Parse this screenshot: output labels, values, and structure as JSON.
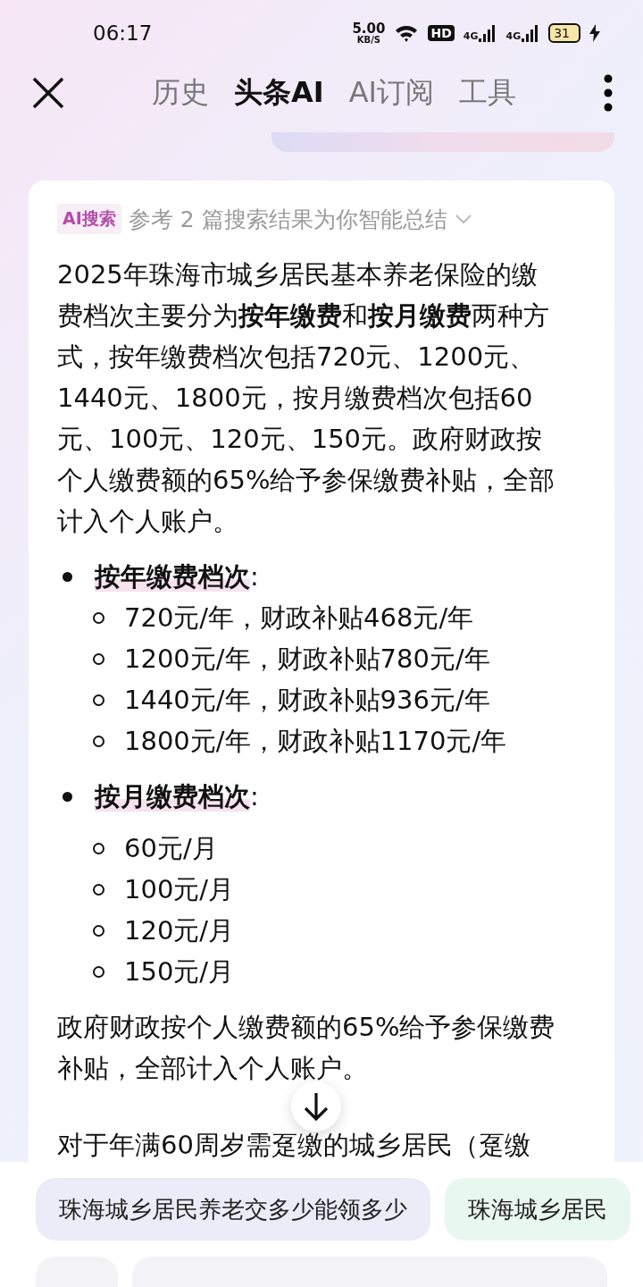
{
  "status_bar": {
    "time": "06:17",
    "speed": "5.00",
    "speed_unit": "KB/S",
    "hd_label": "HD",
    "network_labels": [
      "4G",
      "4G"
    ],
    "battery": "31"
  },
  "nav": {
    "tabs": [
      {
        "label": "历史",
        "selected": false
      },
      {
        "label": "头条AI",
        "selected": true
      },
      {
        "label": "AI订阅",
        "selected": false
      },
      {
        "label": "工具",
        "selected": false
      }
    ]
  },
  "answer": {
    "source_badge": "AI搜索",
    "source_text": "参考 2 篇搜索结果为你智能总结",
    "intro": "2025年珠海市城乡居民基本养老保险的缴费档次主要分为**按年缴费**和**按月缴费**两种方式，按年缴费档次包括720元、1200元、1440元、1800元，按月缴费档次包括60元、100元、120元、150元。政府财政按个人缴费额的65%给予参保缴费补贴，全部计入个人账户。",
    "list": [
      {
        "label": "按年缴费档次",
        "colon": ":",
        "children": [
          "720元/年，财政补贴468元/年",
          "1200元/年，财政补贴780元/年",
          "1440元/年，财政补贴936元/年",
          "1800元/年，财政补贴1170元/年"
        ]
      },
      {
        "label": "按月缴费档次",
        "colon": ":",
        "children": [
          "60元/月",
          "100元/月",
          "120元/月",
          "150元/月"
        ]
      }
    ],
    "after": [
      "政府财政按个人缴费额的65%给予参保缴费补贴，全部计入个人账户。",
      "对于年满60周岁需趸缴的城乡居民（趸缴"
    ]
  },
  "suggestions": [
    {
      "text": "珠海城乡居民养老交多少能领多少",
      "color": "#ecebf8"
    },
    {
      "text": "珠海城乡居民",
      "color": "#e9f7f1"
    }
  ]
}
